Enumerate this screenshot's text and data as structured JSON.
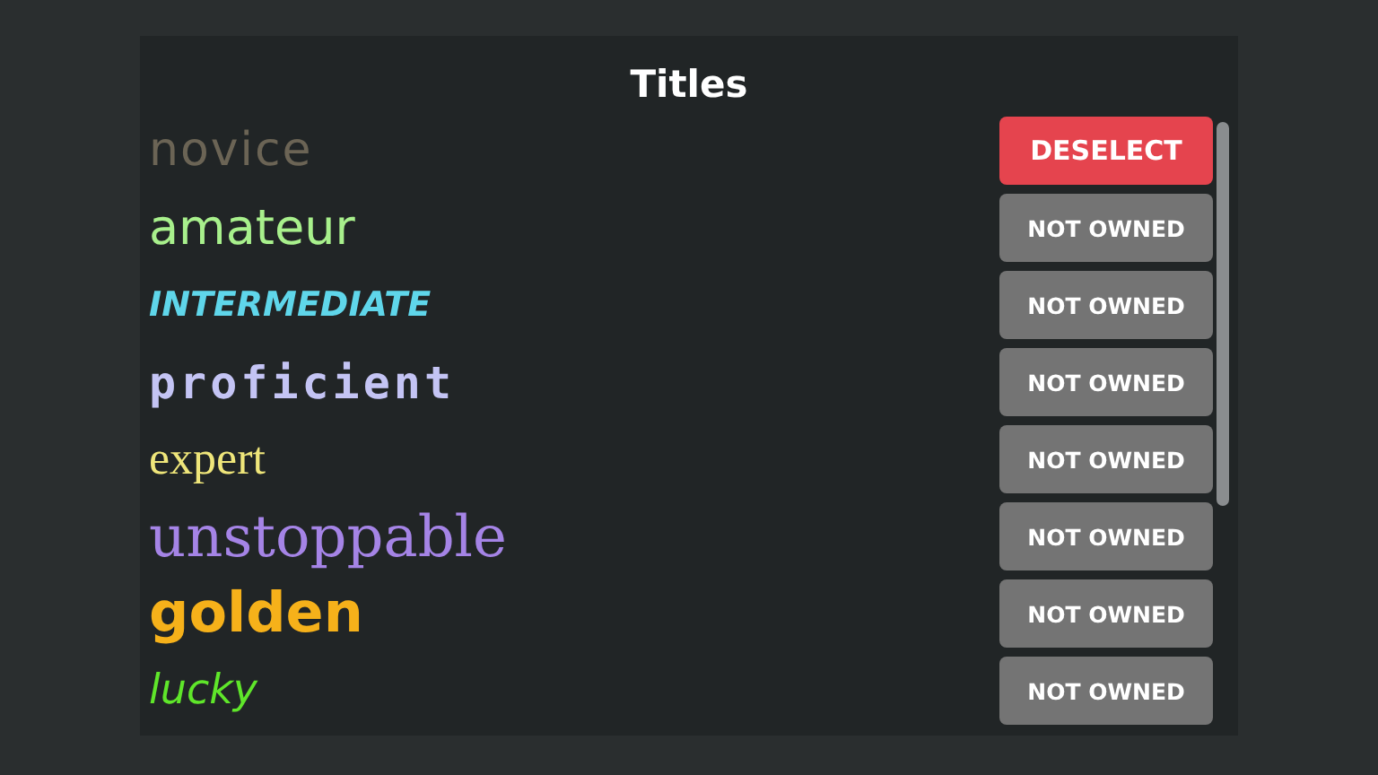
{
  "panel": {
    "title": "Titles"
  },
  "titles": [
    {
      "name": "novice",
      "color": "#6b6455",
      "kind": "rounded",
      "selected": true,
      "button": "DESELECT"
    },
    {
      "name": "amateur",
      "color": "#a8f08c",
      "kind": "plain",
      "selected": false,
      "button": "NOT OWNED"
    },
    {
      "name": "INTERMEDIATE",
      "color": "#5fd6ea",
      "kind": "comic",
      "selected": false,
      "button": "NOT OWNED"
    },
    {
      "name": "proficient",
      "color": "#c4c4f4",
      "kind": "pixel",
      "selected": false,
      "button": "NOT OWNED"
    },
    {
      "name": "expert",
      "color": "#efe67a",
      "kind": "serif",
      "selected": false,
      "button": "NOT OWNED"
    },
    {
      "name": "unstoppable",
      "color": "#a584e6",
      "kind": "slab",
      "selected": false,
      "button": "NOT OWNED"
    },
    {
      "name": "golden",
      "color": "#f6b11a",
      "kind": "heavy",
      "selected": false,
      "button": "NOT OWNED"
    },
    {
      "name": "lucky",
      "color": "#5fe62a",
      "kind": "hand",
      "selected": false,
      "button": "NOT OWNED"
    }
  ]
}
